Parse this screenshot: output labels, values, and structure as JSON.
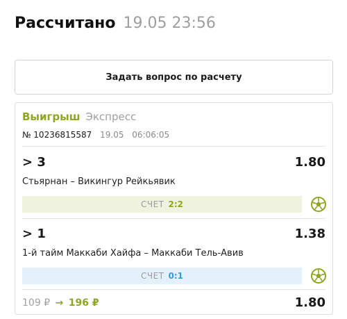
{
  "header": {
    "title": "Рассчитано",
    "datetime": "19.05 23:56"
  },
  "ask_button": {
    "label": "Задать вопрос по расчету"
  },
  "coupon": {
    "status": "Выигрыш",
    "bet_type": "Экспресс",
    "number": "№ 10236815587",
    "date": "19.05",
    "time": "06:06:05",
    "bets": [
      {
        "outcome": "> 3",
        "odd": "1.80",
        "match": "Стьярнан – Викингур Рейкьявик",
        "score_label": "СЧЕТ",
        "score": "2:2",
        "icon": "soccer-ball-icon"
      },
      {
        "outcome": "> 1",
        "odd": "1.38",
        "match": "1-й тайм Маккаби Хайфа – Маккаби Тель-Авив",
        "score_label": "СЧЕТ",
        "score": "0:1",
        "icon": "soccer-ball-icon"
      }
    ],
    "stake": "109 ₽",
    "arrow": "→",
    "payout": "196 ₽",
    "total_odd": "1.80"
  },
  "colors": {
    "win_green": "#8fa524",
    "score_blue": "#3a9bd6",
    "score_green_bg": "#eef2de",
    "score_blue_bg": "#e4f1fb"
  }
}
